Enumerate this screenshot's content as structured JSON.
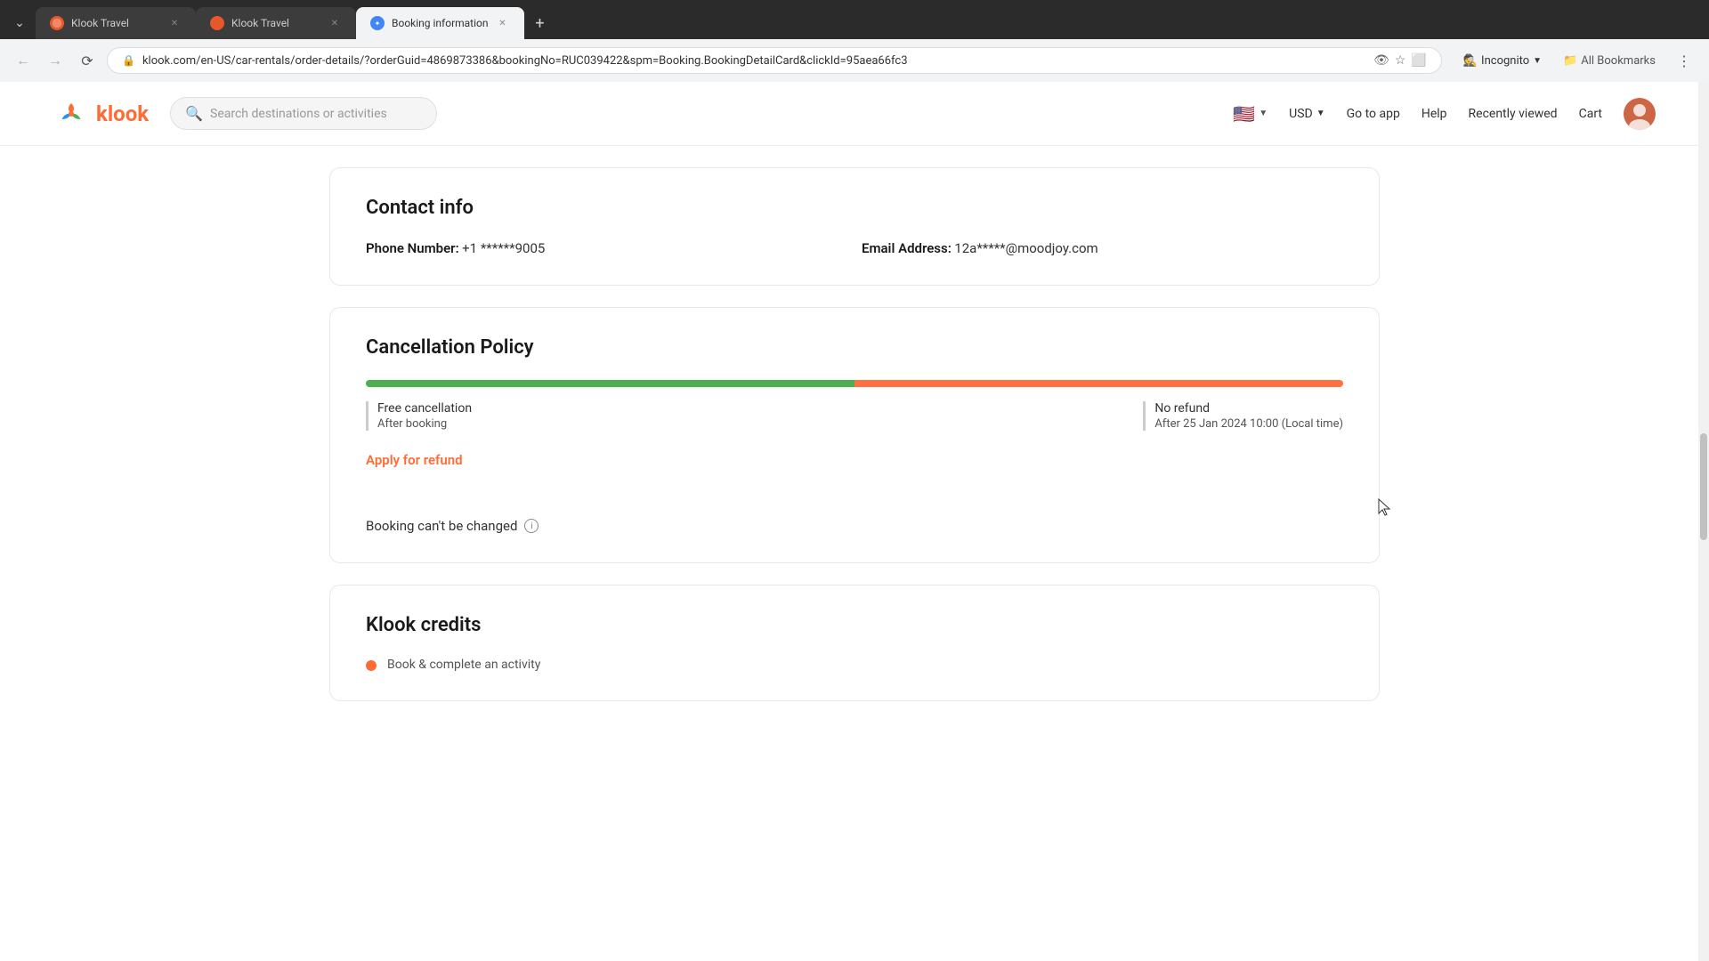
{
  "browser": {
    "tabs": [
      {
        "id": "tab1",
        "favicon_color": "#e8572a",
        "title": "Klook Travel",
        "active": false
      },
      {
        "id": "tab2",
        "favicon_color": "#e8572a",
        "title": "Klook Travel",
        "active": false
      },
      {
        "id": "tab3",
        "favicon_color": "#4285f4",
        "title": "Booking information",
        "active": true
      }
    ],
    "url": "klook.com/en-US/car-rentals/order-details/?orderGuid=4869873386&bookingNo=RUC039422&spm=Booking.BookingDetailCard&clickId=95aea66fc3",
    "profile": "Incognito",
    "bookmarks_label": "All Bookmarks"
  },
  "nav": {
    "logo_text": "klook",
    "search_placeholder": "Search destinations or activities",
    "currency": "USD",
    "go_to_app": "Go to app",
    "help": "Help",
    "recently_viewed": "Recently viewed",
    "cart": "Cart"
  },
  "contact_section": {
    "title": "Contact info",
    "phone_label": "Phone Number:",
    "phone_value": "+1 ******9005",
    "email_label": "Email Address:",
    "email_value": "12a*****@moodjoy.com"
  },
  "cancellation_section": {
    "title": "Cancellation Policy",
    "bar_green_pct": 50,
    "bar_orange_pct": 50,
    "free_label": "Free cancellation",
    "free_sub": "After booking",
    "no_refund_label": "No refund",
    "no_refund_sub": "After 25 Jan 2024 10:00 (Local time)",
    "apply_refund": "Apply for refund",
    "booking_change": "Booking can't be changed"
  },
  "credits_section": {
    "title": "Klook credits",
    "item1": "Book & complete an activity"
  }
}
